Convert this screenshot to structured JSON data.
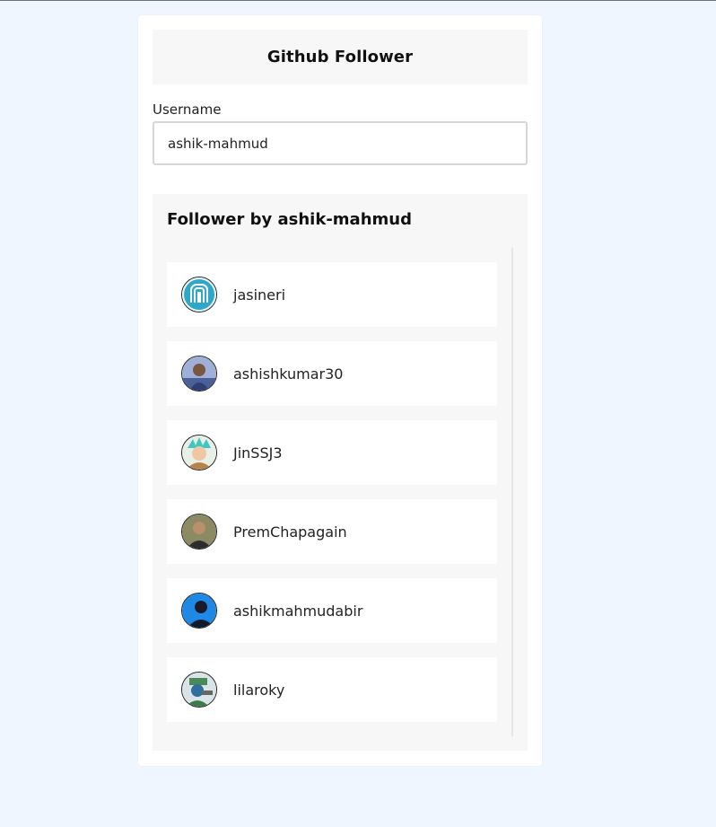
{
  "header": {
    "title": "Github Follower"
  },
  "search": {
    "label": "Username",
    "value": "ashik-mahmud"
  },
  "followers": {
    "title": "Follower by ashik-mahmud",
    "items": [
      {
        "username": "jasineri",
        "avatar": "logo-avatar"
      },
      {
        "username": "ashishkumar30",
        "avatar": "user-photo-avatar"
      },
      {
        "username": "JinSSJ3",
        "avatar": "anime-avatar"
      },
      {
        "username": "PremChapagain",
        "avatar": "user-photo-avatar"
      },
      {
        "username": "ashikmahmudabir",
        "avatar": "user-photo-avatar"
      },
      {
        "username": "lilaroky",
        "avatar": "cartoon-avatar"
      }
    ]
  }
}
